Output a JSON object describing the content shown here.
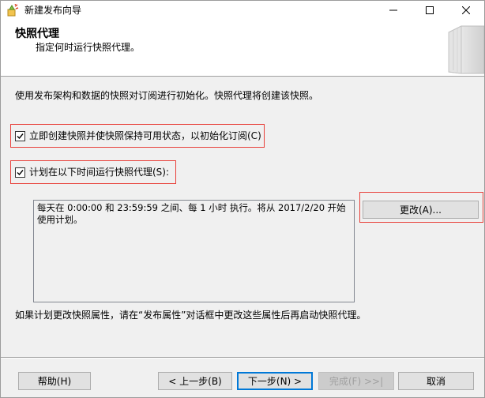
{
  "window": {
    "title": "新建发布向导",
    "icon": "wizard-app-icon"
  },
  "header": {
    "title": "快照代理",
    "subtitle": "指定何时运行快照代理。"
  },
  "main": {
    "intro": "使用发布架构和数据的快照对订阅进行初始化。快照代理将创建该快照。",
    "create_snapshot_checkbox": {
      "label": "立即创建快照并使快照保持可用状态，以初始化订阅(C)",
      "checked": true
    },
    "schedule_checkbox": {
      "label": "计划在以下时间运行快照代理(S):",
      "checked": true
    },
    "schedule_text": "每天在 0:00:00 和 23:59:59 之间、每 1 小时 执行。将从 2017/2/20 开始使用计划。",
    "change_button": "更改(A)...",
    "note": "如果计划更改快照属性，请在“发布属性”对话框中更改这些属性后再启动快照代理。"
  },
  "footer": {
    "help": "帮助(H)",
    "back": "< 上一步(B)",
    "next": "下一步(N) >",
    "finish": "完成(F) >>|",
    "cancel": "取消"
  },
  "colors": {
    "highlight": "#e8403a",
    "default_button_border": "#0078d7",
    "disabled_text": "#a0a0a0"
  }
}
